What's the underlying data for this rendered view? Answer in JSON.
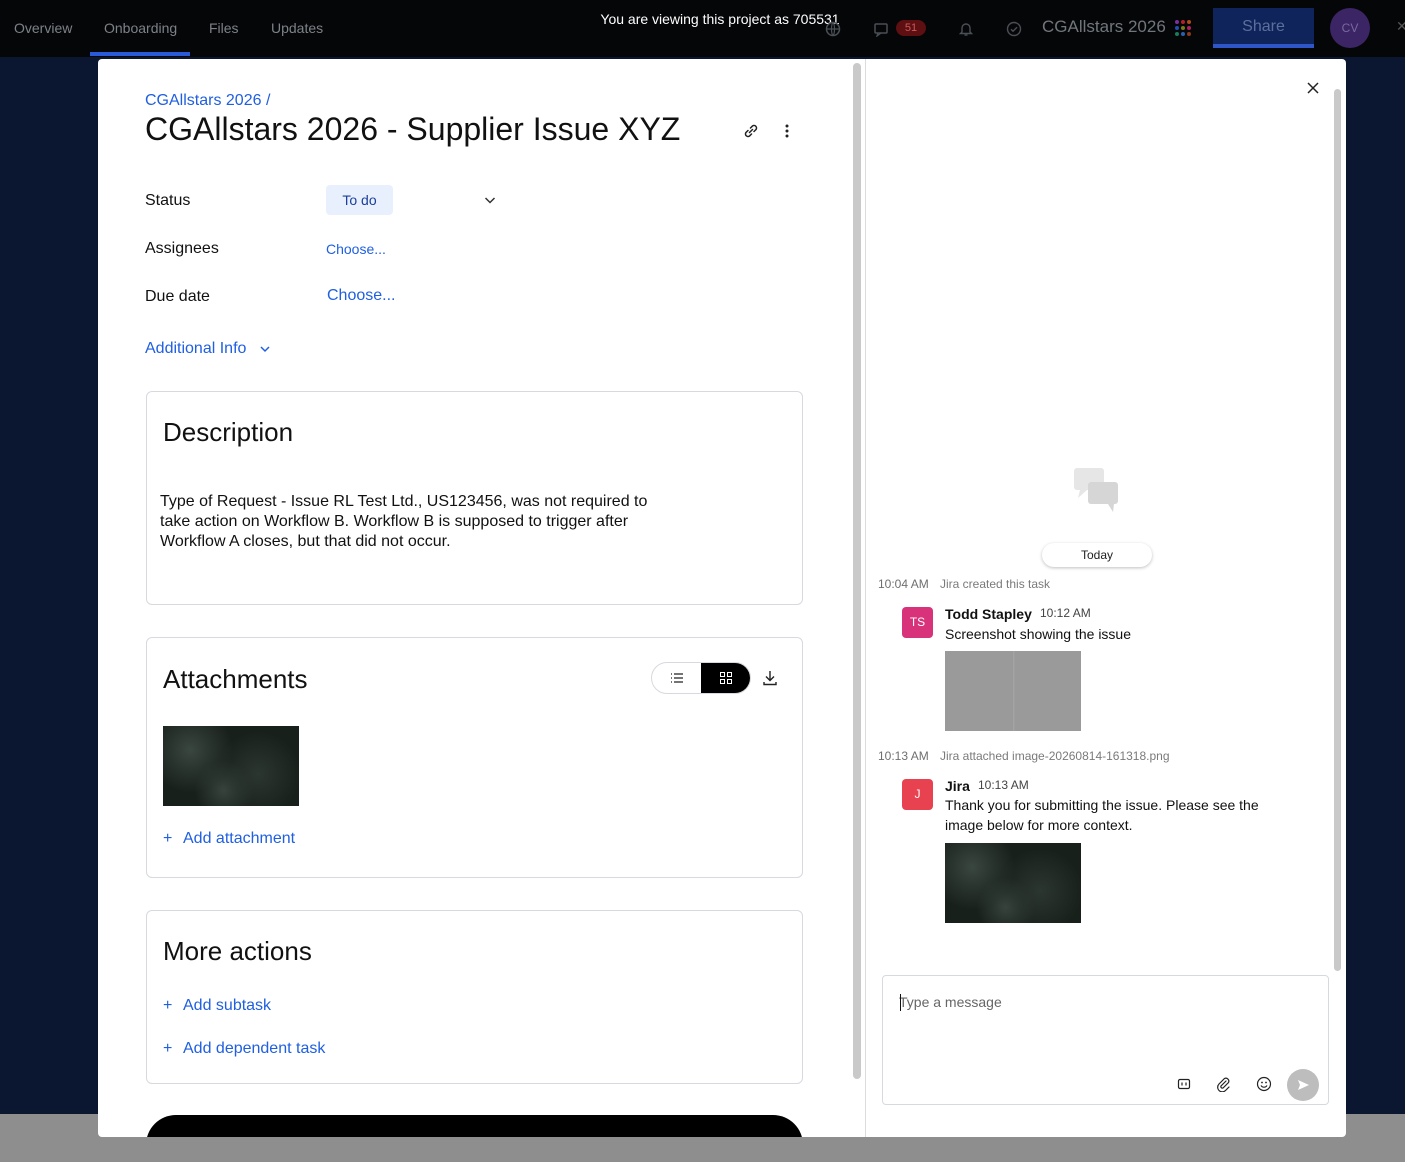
{
  "topbar": {
    "tabs": [
      "Overview",
      "Onboarding",
      "Files",
      "Updates"
    ],
    "viewing_notice": "You are viewing this project as 705531",
    "message_count": "51",
    "project_name": "CGAllstars 2026",
    "share_label": "Share",
    "avatar_initials": "CV",
    "accent": "#2a5ad8"
  },
  "task": {
    "breadcrumb": "CGAllstars 2026 /",
    "title": "CGAllstars 2026 - Supplier Issue XYZ",
    "fields": {
      "status_label": "Status",
      "status_value": "To do",
      "assignees_label": "Assignees",
      "assignees_value": "Choose...",
      "due_label": "Due date",
      "due_value": "Choose..."
    },
    "additional_info": "Additional Info",
    "description": {
      "title": "Description",
      "text": "Type of Request - Issue RL Test Ltd., US123456, was not required to take action on Workflow B. Workflow B is supposed to trigger after Workflow A closes, but that did not occur."
    },
    "attachments": {
      "title": "Attachments",
      "add_label": "Add attachment"
    },
    "more_actions": {
      "title": "More actions",
      "add_subtask": "Add subtask",
      "add_dependent": "Add dependent task"
    }
  },
  "activity": {
    "date_divider": "Today",
    "events": [
      {
        "time": "10:04 AM",
        "text": "Jira created this task"
      },
      {
        "time": "10:13 AM",
        "text": "Jira attached image-20260814-161318.png"
      }
    ],
    "messages": [
      {
        "initials": "TS",
        "author": "Todd Stapley",
        "time": "10:12 AM",
        "text": "Screenshot showing the issue",
        "avatar_color": "#d8337a"
      },
      {
        "initials": "J",
        "author": "Jira",
        "time": "10:13 AM",
        "text": "Thank you for submitting the issue. Please see the image below for more context.",
        "avatar_color": "#e8414f"
      }
    ],
    "composer_placeholder": "Type a message"
  }
}
